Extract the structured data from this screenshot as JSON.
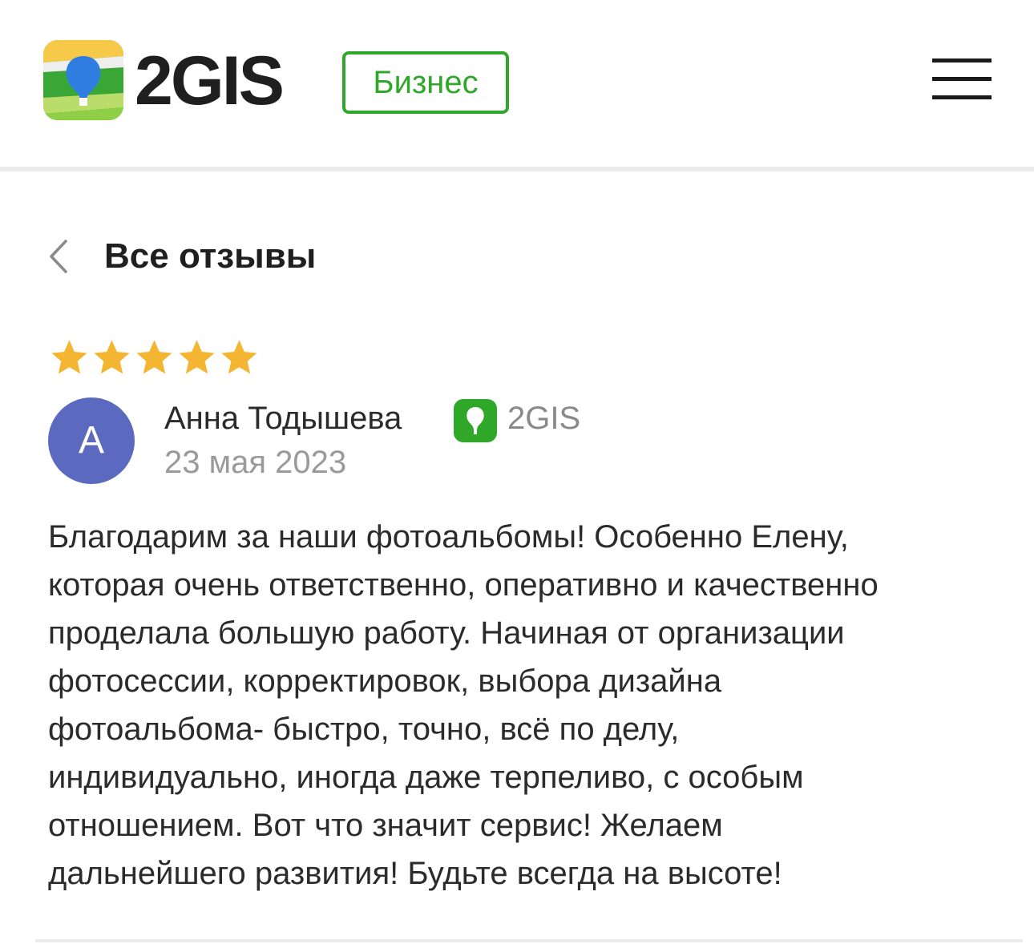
{
  "header": {
    "brand": "2GIS",
    "badge": "Бизнес",
    "menu_icon": "hamburger-menu-icon"
  },
  "back": {
    "icon": "chevron-left-icon",
    "title": "Все отзывы"
  },
  "review": {
    "rating": 5,
    "rating_max": 5,
    "star_color": "#f4b632",
    "avatar_letter": "А",
    "avatar_color": "#5b6abf",
    "author": "Анна Тодышева",
    "source": "2GIS",
    "source_color": "#2fa82a",
    "date": "23 мая 2023",
    "text": "Благодарим за наши фотоальбомы! Особенно Елену,\nкоторая очень ответственно, оперативно и качественно\nпроделала большую работу. Начиная от организации\nфотосессии, корректировок, выбора дизайна\nфотоальбома- быстро, точно, всё по делу,\nиндивидуально, иногда даже терпеливо, с особым\nотношением. Вот что значит сервис! Желаем\nдальнейшего развития! Будьте всегда на высоте!"
  },
  "colors": {
    "brand_green": "#2fa82a",
    "logo_blue": "#2f7de1",
    "logo_yellow": "#f7c948",
    "divider": "#ececec"
  }
}
